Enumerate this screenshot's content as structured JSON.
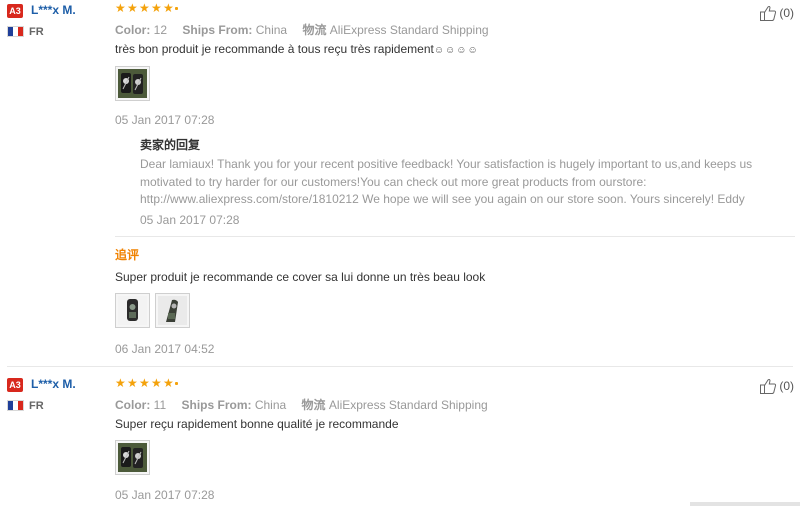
{
  "reviews": [
    {
      "badge": "A3",
      "user": "L***x M.",
      "country": "FR",
      "helpful": "(0)",
      "color_label": "Color:",
      "color_value": "12",
      "ships_label": "Ships From:",
      "ships_value": "China",
      "logistics_label": "物流",
      "logistics_value": "AliExpress Standard Shipping",
      "text": "très bon produit je recommande à tous reçu très rapidement",
      "emoji": "☺☺☺☺",
      "date": "05 Jan 2017 07:28",
      "reply": {
        "title": "卖家的回复",
        "body": "Dear lamiaux! Thank you for your recent positive feedback! Your satisfaction is hugely important to us,and keeps us motivated to try harder for our customers!You can check out more great products from ourstore: http://www.aliexpress.com/store/1810212 We hope we will see you again on our store soon. Yours sincerely! Eddy",
        "date": "05 Jan 2017 07:28"
      },
      "followup": {
        "label": "追评",
        "text": "Super produit je recommande ce cover sa lui donne un très beau look",
        "date": "06 Jan 2017 04:52"
      }
    },
    {
      "badge": "A3",
      "user": "L***x M.",
      "country": "FR",
      "helpful": "(0)",
      "color_label": "Color:",
      "color_value": "11",
      "ships_label": "Ships From:",
      "ships_value": "China",
      "logistics_label": "物流",
      "logistics_value": "AliExpress Standard Shipping",
      "text": "Super reçu rapidement bonne qualité je recommande",
      "date": "05 Jan 2017 07:28"
    }
  ],
  "colors": {
    "badge": "#d8281d",
    "username": "#1d5ea8",
    "star": "#f4a20b",
    "followup_label": "#f08200",
    "muted": "#999999"
  },
  "icons": {
    "helpful": "thumbs-up-icon",
    "flag": "flag-france-icon",
    "rating": "star-icon"
  },
  "ratings": [
    5,
    5
  ]
}
